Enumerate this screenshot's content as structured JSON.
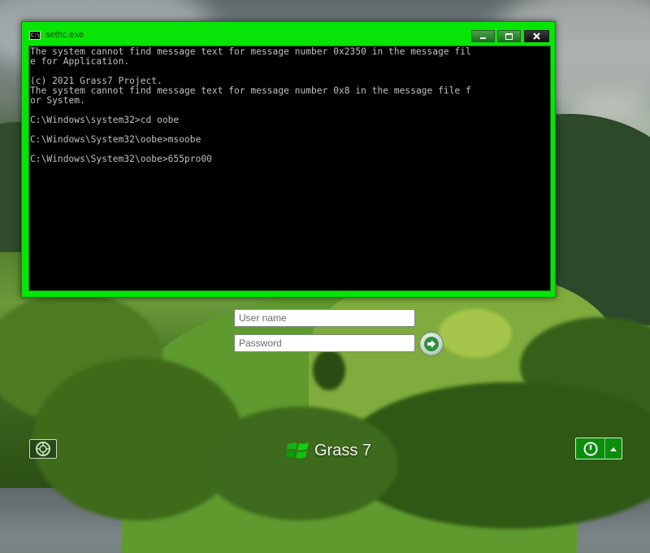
{
  "window": {
    "title": "sethc.exe",
    "icon": "console-icon",
    "icon_glyph": "C:\\",
    "buttons": {
      "minimize": "minimize-icon",
      "maximize": "maximize-icon",
      "close": "close-icon"
    }
  },
  "console": {
    "text": "The system cannot find message text for message number 0x2350 in the message fil\ne for Application.\n\n(c) 2021 Grass7 Project.\nThe system cannot find message text for message number 0x8 in the message file f\nor System.\n\nC:\\Windows\\system32>cd oobe\n\nC:\\Windows\\System32\\oobe>msoobe\n\nC:\\Windows\\System32\\oobe>655pro00"
  },
  "login": {
    "username_placeholder": "User name",
    "password_placeholder": "Password",
    "submit_icon": "arrow-right-icon"
  },
  "footer": {
    "ease_of_access_icon": "ease-of-access-icon",
    "brand_name": "Grass 7",
    "brand_logo": "windows-flag-logo",
    "power_icon": "power-icon",
    "power_options_icon": "triangle-up-icon"
  },
  "colors": {
    "accent": "#06e506",
    "console_bg": "#000000",
    "console_text": "#c0c0c0",
    "power_green": "#0c8e0c"
  }
}
